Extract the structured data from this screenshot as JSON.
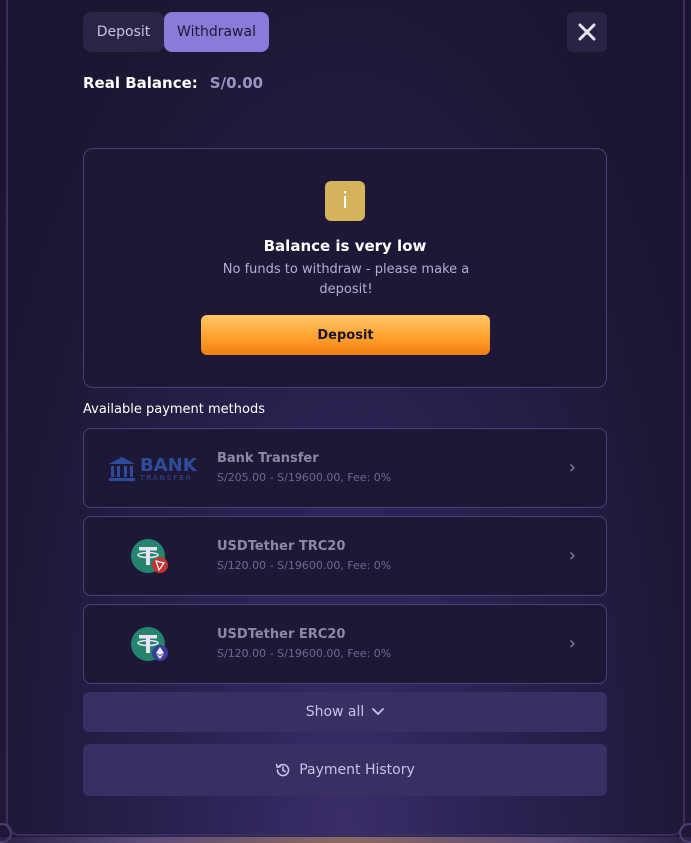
{
  "tabs": {
    "deposit": "Deposit",
    "withdrawal": "Withdrawal",
    "active": "Withdrawal"
  },
  "close_icon": "close-icon",
  "balance": {
    "label": "Real Balance:",
    "value": "S/0.00"
  },
  "low_balance": {
    "icon": "info-icon",
    "icon_glyph": "i",
    "title": "Balance is very low",
    "message": "No funds to withdraw - please make a deposit!",
    "cta": "Deposit"
  },
  "methods": {
    "title": "Available payment methods",
    "items": [
      {
        "name": "Bank Transfer",
        "range": "S/205.00 - S/19600.00, Fee: 0%",
        "logo_text": "BANK",
        "logo_sub": "TRANSFER"
      },
      {
        "name": "USDTether TRC20",
        "range": "S/120.00 - S/19600.00, Fee: 0%"
      },
      {
        "name": "USDTether ERC20",
        "range": "S/120.00 - S/19600.00, Fee: 0%"
      }
    ]
  },
  "show_all": "Show all",
  "payment_history": "Payment History",
  "colors": {
    "accent": "#8c7ad8",
    "cta": "#ff9e2b",
    "panel": "#1e1836",
    "tether": "#26a17b"
  }
}
